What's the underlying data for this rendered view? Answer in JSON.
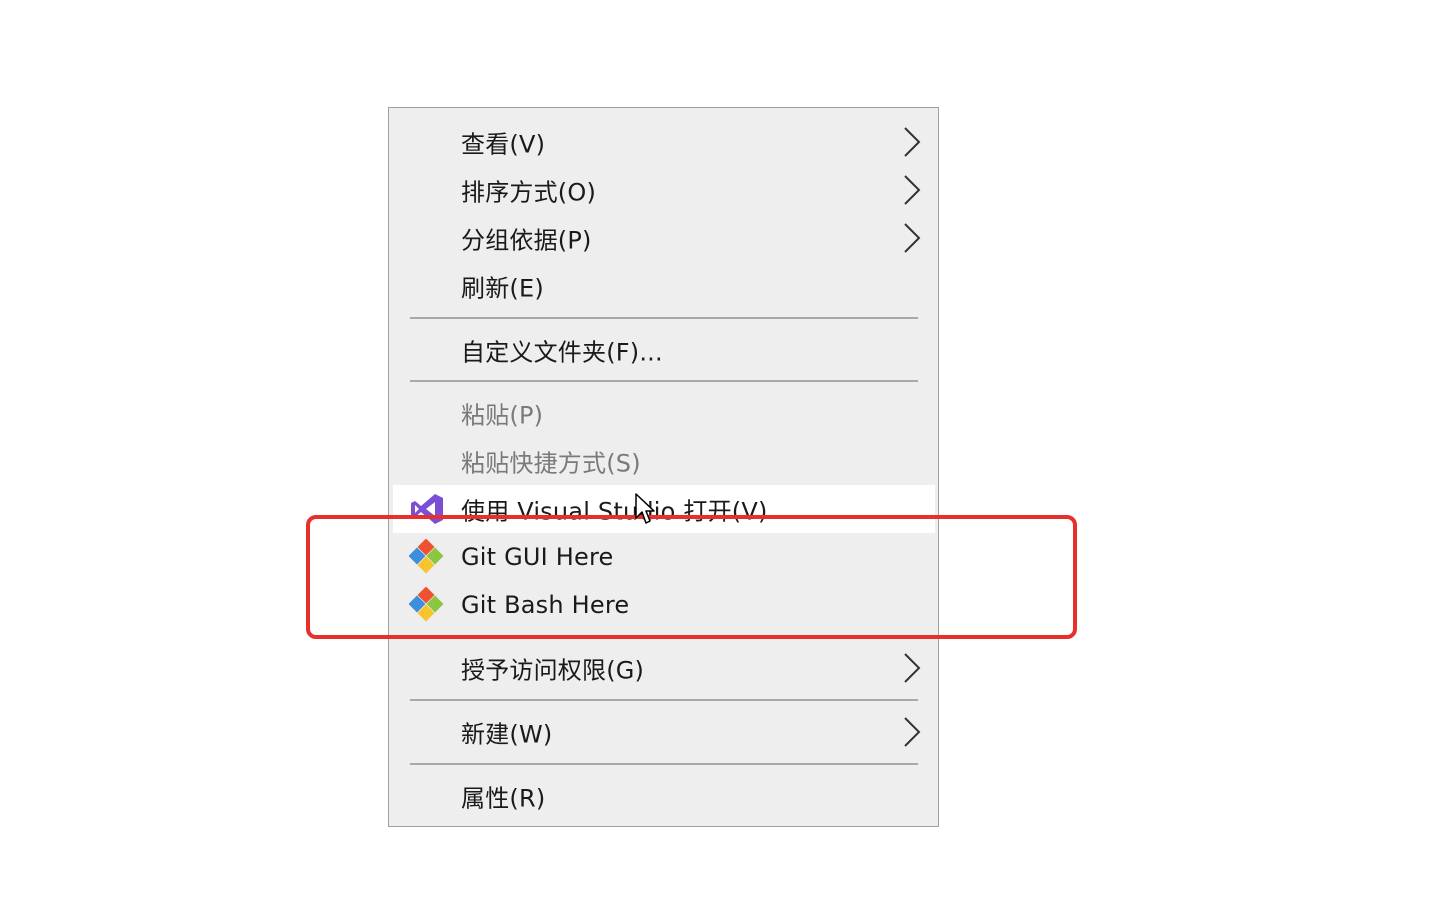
{
  "context_menu": {
    "items": [
      {
        "label": "查看(V)",
        "submenu": true,
        "disabled": false
      },
      {
        "label": "排序方式(O)",
        "submenu": true,
        "disabled": false
      },
      {
        "label": "分组依据(P)",
        "submenu": true,
        "disabled": false
      },
      {
        "label": "刷新(E)",
        "submenu": false,
        "disabled": false
      },
      {
        "label": "自定义文件夹(F)...",
        "submenu": false,
        "disabled": false
      },
      {
        "label": "粘贴(P)",
        "submenu": false,
        "disabled": true
      },
      {
        "label": "粘贴快捷方式(S)",
        "submenu": false,
        "disabled": true
      },
      {
        "label": "使用 Visual Studio 打开(V)",
        "submenu": false,
        "disabled": false,
        "icon": "visual-studio-icon",
        "hovered": true
      },
      {
        "label": "Git GUI Here",
        "submenu": false,
        "disabled": false,
        "icon": "git-icon"
      },
      {
        "label": "Git Bash Here",
        "submenu": false,
        "disabled": false,
        "icon": "git-icon"
      },
      {
        "label": "授予访问权限(G)",
        "submenu": true,
        "disabled": false
      },
      {
        "label": "新建(W)",
        "submenu": true,
        "disabled": false
      },
      {
        "label": "属性(R)",
        "submenu": false,
        "disabled": false
      }
    ]
  },
  "colors": {
    "menu_background": "#eeeeee",
    "hover_background": "#ffffff",
    "highlight_border": "#e8302a",
    "disabled_text": "#7a7a7a",
    "git_orange": "#f05133",
    "git_green": "#8cc63f",
    "git_blue": "#3c8ede",
    "git_yellow": "#f7c52b",
    "vs_purple": "#7b4ed6"
  }
}
